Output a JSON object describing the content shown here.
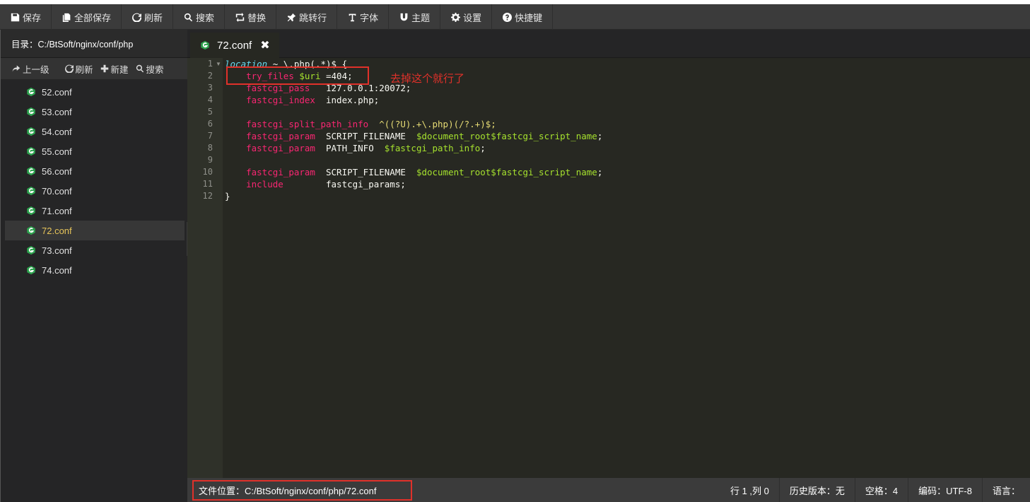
{
  "toolbar": {
    "buttons": [
      {
        "label": "保存",
        "icon": "floppy-icon"
      },
      {
        "label": "全部保存",
        "icon": "copy-icon"
      },
      {
        "label": "刷新",
        "icon": "refresh-icon"
      },
      {
        "label": "搜索",
        "icon": "search-icon"
      },
      {
        "label": "替换",
        "icon": "retweet-icon"
      },
      {
        "label": "跳转行",
        "icon": "pushpin-icon"
      },
      {
        "label": "字体",
        "icon": "text-height-icon"
      },
      {
        "label": "主题",
        "icon": "magnet-icon"
      },
      {
        "label": "设置",
        "icon": "gear-icon"
      },
      {
        "label": "快捷键",
        "icon": "question-circle-icon"
      }
    ]
  },
  "sidebar": {
    "path_label": "目录：C:/BtSoft/nginx/conf/php",
    "actions": [
      {
        "label": "上一级",
        "icon": "share-arrow-icon"
      },
      {
        "label": "刷新",
        "icon": "refresh-icon"
      },
      {
        "label": "新建",
        "icon": "plus-icon"
      },
      {
        "label": "搜索",
        "icon": "search-icon"
      }
    ],
    "files": [
      "52.conf",
      "53.conf",
      "54.conf",
      "55.conf",
      "56.conf",
      "70.conf",
      "71.conf",
      "72.conf",
      "73.conf",
      "74.conf"
    ],
    "active_file": "72.conf"
  },
  "editor": {
    "tab_label": "72.conf",
    "line_numbers": [
      "1",
      "2",
      "3",
      "4",
      "5",
      "6",
      "7",
      "8",
      "9",
      "10",
      "11",
      "12"
    ],
    "code": {
      "l1_kw": "location",
      "l1_rest": " ~ \\.php(.*)$ {",
      "l2_dir": "try_files",
      "l2_var": "$uri",
      "l2_rest": " =404;",
      "l3_dir": "fastcgi_pass",
      "l3_rest": "   127.0.0.1:20072;",
      "l4_dir": "fastcgi_index",
      "l4_rest": "  index.php;",
      "l6_dir": "fastcgi_split_path_info",
      "l6_rest": "  ^((?U).+\\.php)(/?.+)$;",
      "l7_dir": "fastcgi_param",
      "l7_mid": "  SCRIPT_FILENAME  ",
      "l7_var": "$document_root$fastcgi_script_name",
      "l7_end": ";",
      "l8_dir": "fastcgi_param",
      "l8_mid": "  PATH_INFO  ",
      "l8_var": "$fastcgi_path_info",
      "l8_end": ";",
      "l10_dir": "fastcgi_param",
      "l10_mid": "  SCRIPT_FILENAME  ",
      "l10_var": "$document_root$fastcgi_script_name",
      "l10_end": ";",
      "l11_dir": "include",
      "l11_rest": "        fastcgi_params;",
      "l12": "}"
    },
    "annotation": "去掉这个就行了"
  },
  "statusbar": {
    "file_location": "文件位置：C:/BtSoft/nginx/conf/php/72.conf",
    "cursor": "行 1 ,列 0",
    "history": "历史版本：无",
    "indent": "空格：4",
    "encoding": "编码：UTF-8",
    "language": "语言："
  },
  "colors": {
    "keyword_pink": "#f92672",
    "variable_green": "#a6e22e",
    "string_yellow": "#e6db74",
    "active_file": "#e6c45a",
    "annotation_red": "#e0312a",
    "file_icon_green": "#2ea44f"
  }
}
